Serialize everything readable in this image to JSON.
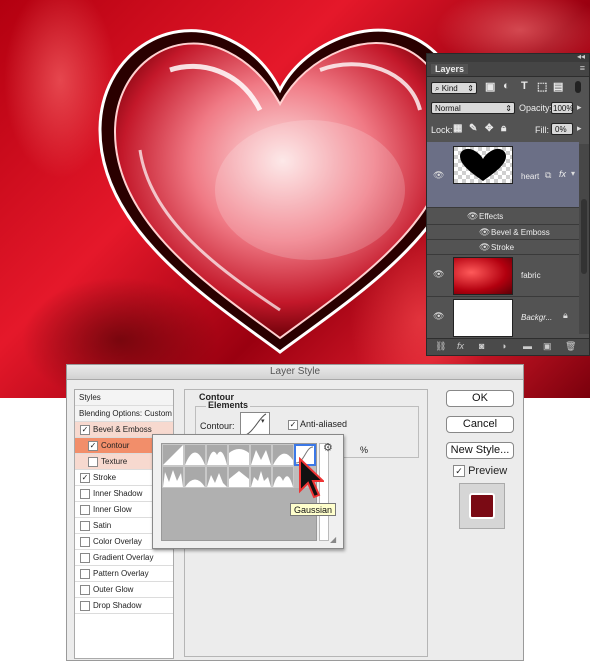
{
  "layers_panel": {
    "tab_label": "Layers",
    "kind_label": "Kind",
    "blend_mode": "Normal",
    "opacity_label": "Opacity:",
    "opacity_value": "100%",
    "lock_label": "Lock:",
    "fill_label": "Fill:",
    "fill_value": "0%",
    "layers": [
      {
        "name": "heart"
      },
      {
        "name": "fabric"
      },
      {
        "name": "Backgr..."
      }
    ],
    "effects_label": "Effects",
    "effects": [
      "Bevel & Emboss",
      "Stroke"
    ]
  },
  "dialog": {
    "title": "Layer Style",
    "styles_header": "Styles",
    "blending_options": "Blending Options: Custom",
    "style_items": [
      {
        "label": "Bevel & Emboss",
        "checked": true
      },
      {
        "label": "Contour",
        "checked": true
      },
      {
        "label": "Texture",
        "checked": false
      },
      {
        "label": "Stroke",
        "checked": true
      },
      {
        "label": "Inner Shadow",
        "checked": false
      },
      {
        "label": "Inner Glow",
        "checked": false
      },
      {
        "label": "Satin",
        "checked": false
      },
      {
        "label": "Color Overlay",
        "checked": false
      },
      {
        "label": "Gradient Overlay",
        "checked": false
      },
      {
        "label": "Pattern Overlay",
        "checked": false
      },
      {
        "label": "Outer Glow",
        "checked": false
      },
      {
        "label": "Drop Shadow",
        "checked": false
      }
    ],
    "section_title": "Contour",
    "elements_title": "Elements",
    "contour_label": "Contour:",
    "anti_aliased_label": "Anti-aliased",
    "percent_sign": "%",
    "buttons": {
      "ok": "OK",
      "cancel": "Cancel",
      "new_style": "New Style...",
      "preview": "Preview"
    },
    "tooltip": "Gaussian"
  }
}
